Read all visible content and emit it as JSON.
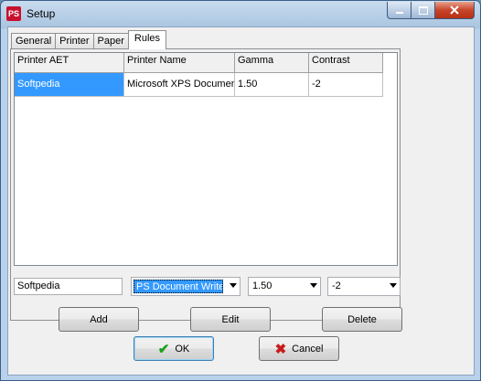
{
  "window": {
    "title": "Setup",
    "app_icon_text": "PS"
  },
  "tabs": [
    {
      "label": "General"
    },
    {
      "label": "Printer"
    },
    {
      "label": "Paper"
    },
    {
      "label": "Rules"
    }
  ],
  "grid": {
    "headers": [
      "Printer AET",
      "Printer Name",
      "Gamma",
      "Contrast"
    ],
    "rows": [
      {
        "aet": "Softpedia",
        "printer": "Microsoft XPS Document Writer",
        "gamma": "1.50",
        "contrast": "-2"
      }
    ]
  },
  "edit": {
    "aet_value": "Softpedia",
    "printer_value": "PS Document Writer",
    "gamma_value": "1.50",
    "contrast_value": "-2"
  },
  "buttons": {
    "add": "Add",
    "edit": "Edit",
    "delete": "Delete",
    "ok": "OK",
    "cancel": "Cancel"
  },
  "icons": {
    "min": "minimize-icon",
    "max": "maximize-icon",
    "close": "close-icon"
  },
  "colors": {
    "selection": "#3399ff",
    "close_button": "#c7452b"
  }
}
